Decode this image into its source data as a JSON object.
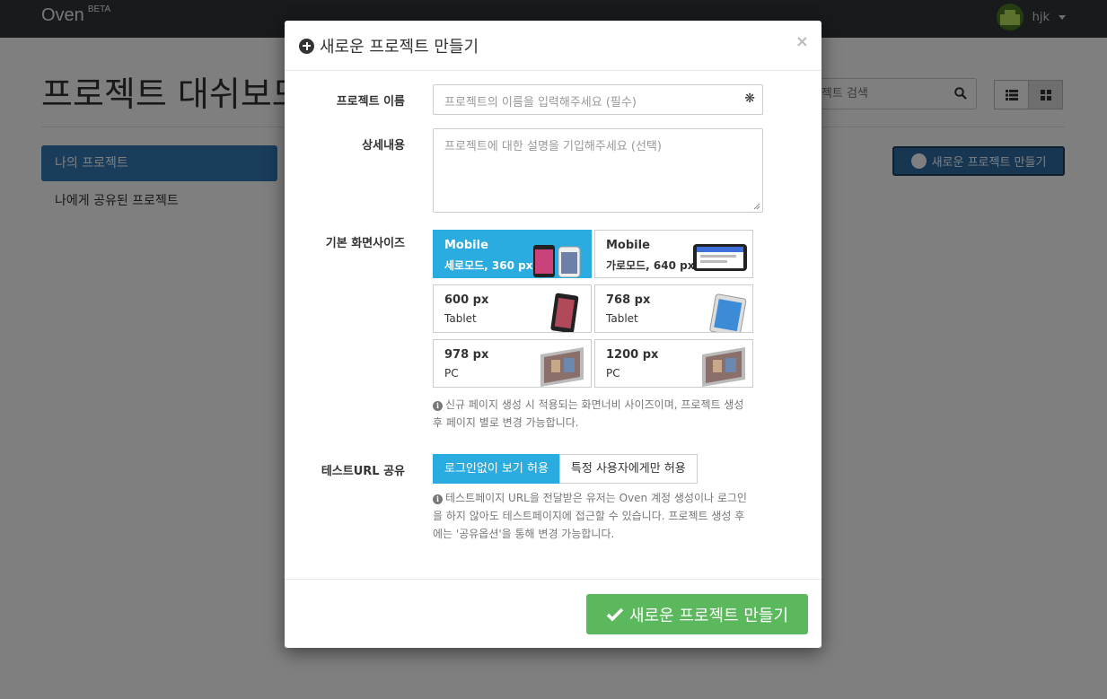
{
  "app": {
    "brand": "Oven",
    "beta": "BETA",
    "user": "hjk"
  },
  "page": {
    "title": "프로젝트 대쉬보드",
    "search_placeholder": "프로젝트 검색",
    "sidebar": [
      "나의 프로젝트",
      "나에게 공유된 프로젝트"
    ],
    "new_project_button": "새로운 프로젝트 만들기"
  },
  "modal": {
    "title": "새로운 프로젝트 만들기",
    "close": "×",
    "name_label": "프로젝트 이름",
    "name_placeholder": "프로젝트의 이름을 입력해주세요 (필수)",
    "required_mark": "❋",
    "desc_label": "상세내용",
    "desc_placeholder": "프로젝트에 대한 설명을 기입해주세요 (선택)",
    "size_label": "기본 화면사이즈",
    "sizes": [
      {
        "title": "Mobile",
        "sub": "세로모드, 360 px"
      },
      {
        "title": "Mobile",
        "sub": "가로모드, 640 px"
      },
      {
        "title": "600 px",
        "sub": "Tablet"
      },
      {
        "title": "768 px",
        "sub": "Tablet"
      },
      {
        "title": "978 px",
        "sub": "PC"
      },
      {
        "title": "1200 px",
        "sub": "PC"
      }
    ],
    "size_help_1": "신규 페이지 생성 시 적용되는 화면너비 사이즈이며, 프로젝트 생성",
    "size_help_2": "후 페이지 별로 변경 가능합니다.",
    "share_label": "테스트URL 공유",
    "share_options": [
      "로그인없이 보기 허용",
      "특정 사용자에게만 허용"
    ],
    "share_help_1": "테스트페이지 URL을 전달받은 유저는 Oven 계정 생성이나 로그인",
    "share_help_2": "을 하지 않아도 테스트페이지에 접근할 수 있습니다. 프로젝트 생성 후",
    "share_help_3": "에는 '공유옵션'을 통해 변경 가능합니다.",
    "submit": "새로운 프로젝트 만들기"
  },
  "colors": {
    "accent": "#2bace0",
    "success": "#5cb85c",
    "primary": "#337ab7",
    "navbar": "#303538"
  }
}
